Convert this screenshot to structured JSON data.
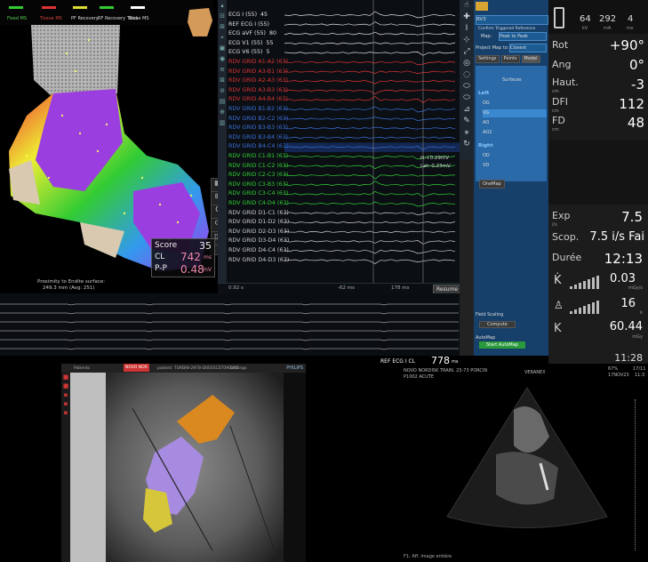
{
  "legend_top": [
    "Fixed MS",
    "Tissue MS",
    "PF Recovery",
    "RF Recovery Tissue MS",
    "Blck"
  ],
  "map": {
    "score_label": "Score",
    "score_value": "35",
    "cl_label": "CL",
    "cl_value": "742",
    "cl_unit": "ms",
    "pp_label": "P-P",
    "pp_value": "0.48",
    "pp_unit": "mV",
    "proximity_line1": "Proximity to Endite surface:",
    "proximity_line2": "249.3 mm (Avg: 251)"
  },
  "ecg": {
    "channels": [
      {
        "label": "ECG I (55)",
        "value": "45",
        "color": "#e0e0e0"
      },
      {
        "label": "REF ECG I (55)",
        "value": "",
        "color": "#e0e0e0"
      },
      {
        "label": "ECG aVF (55)",
        "value": "80",
        "color": "#e0e0e0"
      },
      {
        "label": "ECG V1 (55)",
        "value": "55",
        "color": "#e0e0e0"
      },
      {
        "label": "ECG V6 (55)",
        "value": "5",
        "color": "#e0e0e0"
      },
      {
        "label": "RDV GRID A1-A2 (63)",
        "value": "",
        "color": "#d33"
      },
      {
        "label": "RDV GRID A3-B1 (63)",
        "value": "",
        "color": "#d33"
      },
      {
        "label": "RDV GRID A2-A3 (63)",
        "value": "",
        "color": "#d33"
      },
      {
        "label": "RDV GRID A3-B3 (63)",
        "value": "",
        "color": "#d33"
      },
      {
        "label": "RDV GRID A4-B4 (63)",
        "value": "",
        "color": "#d33"
      },
      {
        "label": "RDV GRID B1-B2 (63)",
        "value": "",
        "color": "#3a6fd8"
      },
      {
        "label": "RDV GRID B2-C2 (63)",
        "value": "",
        "color": "#3a6fd8"
      },
      {
        "label": "RDV GRID B3-B3 (63)",
        "value": "",
        "color": "#3a6fd8"
      },
      {
        "label": "RDV GRID B3-B4 (63)",
        "value": "",
        "color": "#3a6fd8"
      },
      {
        "label": "RDV GRID B4-C4 (63)",
        "value": "",
        "color": "#3a6fd8"
      },
      {
        "label": "RDV GRID C1-B1 (63)",
        "value": "",
        "color": "#3c3"
      },
      {
        "label": "RDV GRID C1-C2 (63)",
        "value": "",
        "color": "#3c3"
      },
      {
        "label": "RDV GRID C2-C3 (63)",
        "value": "",
        "color": "#3c3"
      },
      {
        "label": "RDV GRID C3-B3 (63)",
        "value": "",
        "color": "#3c3"
      },
      {
        "label": "RDV GRID C3-C4 (63)",
        "value": "",
        "color": "#3c3"
      },
      {
        "label": "RDV GRID C4-D4 (63)",
        "value": "",
        "color": "#3c3"
      },
      {
        "label": "RDV GRID D1-C1 (63)",
        "value": "",
        "color": "#ccc"
      },
      {
        "label": "RDV GRID D1-D2 (63)",
        "value": "",
        "color": "#ccc"
      },
      {
        "label": "RDV GRID D2-D3 (63)",
        "value": "",
        "color": "#ccc"
      },
      {
        "label": "RDV GRID D3-D4 (63)",
        "value": "",
        "color": "#ccc"
      },
      {
        "label": "RDV GRID D4-C4 (63)",
        "value": "",
        "color": "#ccc"
      },
      {
        "label": "RDV GRID D4-D3 (63)",
        "value": "",
        "color": "#ccc"
      }
    ],
    "annot1": "H:+0.29mV",
    "annot2": "Lat:-0.23mV",
    "bottom_left": "0.92 s",
    "bottom_mid": "-62 ms",
    "bottom_right": "178 ms",
    "resume": "Resume"
  },
  "side": {
    "dropdown1": "RV3",
    "dropdown2": "Confirm Triggered Reference",
    "map_label": "Map:",
    "map_value": "Peak to Peak",
    "project_label": "Project Map to:",
    "project_value": "Closest",
    "tabs": [
      "Settings",
      "Points",
      "Model"
    ],
    "surfaces_btn": "Surfaces",
    "left_label": "Left",
    "left_items": [
      "OG",
      "VG",
      "AO",
      "AO2"
    ],
    "right_label": "Right",
    "right_items": [
      "OD",
      "VD"
    ],
    "onemap": "OneMap",
    "field_scaling": "Field Scaling",
    "compute": "Compute",
    "automap": "AutoMap",
    "start_automap": "Start AutoMap"
  },
  "stats": {
    "kv": "64",
    "kv_unit": "kV",
    "ma": "292",
    "ma_unit": "mA",
    "ms": "4",
    "ms_unit": "ms",
    "rows": [
      {
        "label": "Rot",
        "value": "+90°"
      },
      {
        "label": "Ang",
        "value": "0°"
      },
      {
        "label": "Haut.",
        "unit": "cm",
        "value": "-3"
      },
      {
        "label": "DFI",
        "unit": "cm",
        "value": "112"
      },
      {
        "label": "FD",
        "unit": "cm",
        "value": "48"
      }
    ],
    "exp_label": "Exp",
    "exp_unit": "i/s",
    "exp_value": "7.5",
    "scop_label": "Scop.",
    "scop_value": "7.5 i/s Fai",
    "duree_label": "Durée",
    "duree_value": "12:13",
    "k1_value": "0.03",
    "k1_unit": "mGy/s",
    "k2_value": "16",
    "k2_unit": "k",
    "k_label": "K",
    "k3_value": "60.44",
    "k3_unit": "mGy",
    "time": "11:28"
  },
  "fluoro": {
    "tab1": "Patients",
    "tab2": "NOVO NOR",
    "tab3": "patient: TURBIN-2978-D0035CET090251",
    "tab4": "Settings",
    "brand": "PHILIPS"
  },
  "echo": {
    "ref_label": "REF ECG I CL",
    "ref_value": "778",
    "ref_unit": "ms",
    "line1": "NOVO NORDISK TRAIN. 23-73 PORCIN",
    "line2": "P1002 ACUTE",
    "brand": "VERANEX",
    "pct": "67%",
    "date1": "17/11",
    "date2": "17NOV23",
    "time": "11:3",
    "footer": "F1: Aff. image entière"
  }
}
